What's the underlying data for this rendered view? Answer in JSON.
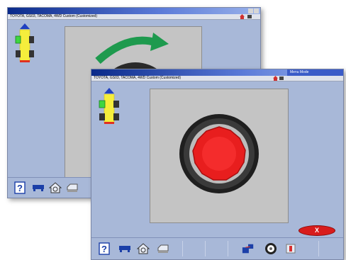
{
  "back_window": {
    "title": "",
    "subtitle": "TOYOTA, GS03, TACOMA, 4WD Custom (Customized)"
  },
  "front_window": {
    "title": "",
    "subtitle": "TOYOTA, GS03, TACOMA, 4WD Custom (Customized)",
    "mode_label": "Menu Mode",
    "close_label": "X"
  },
  "toolbar_icons": [
    "help-icon",
    "vehicle-specs-icon",
    "home-icon",
    "print-icon",
    "share-icon",
    "wheel-icon",
    "shutdown-icon"
  ],
  "colors": {
    "window_bg": "#a8b8d8",
    "panel_bg": "#c4c4c4",
    "indicator_yellow": "#f5ee3c",
    "indicator_blue": "#2040c0",
    "indicator_green": "#3ed640",
    "indicator_red": "#e03020",
    "arrow_green": "#1e9a4e",
    "wheel_red": "#e81e1e",
    "close_red": "#d81c1c"
  }
}
